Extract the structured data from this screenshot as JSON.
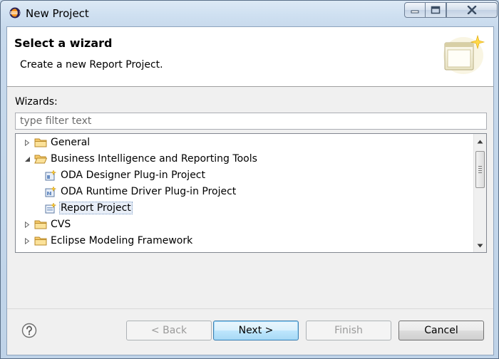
{
  "window": {
    "title": "New Project"
  },
  "header": {
    "title": "Select a wizard",
    "description": "Create a new Report Project."
  },
  "wizards": {
    "label": "Wizards:",
    "filter_placeholder": "type filter text",
    "tree": [
      {
        "label": "General",
        "type": "folder",
        "expanded": false,
        "level": 0
      },
      {
        "label": "Business Intelligence and Reporting Tools",
        "type": "folder",
        "expanded": true,
        "level": 0
      },
      {
        "label": "ODA Designer Plug-in Project",
        "type": "project",
        "level": 1
      },
      {
        "label": "ODA Runtime Driver Plug-in Project",
        "type": "project",
        "level": 1
      },
      {
        "label": "Report Project",
        "type": "project",
        "level": 1,
        "selected": true
      },
      {
        "label": "CVS",
        "type": "folder",
        "expanded": false,
        "level": 0
      },
      {
        "label": "Eclipse Modeling Framework",
        "type": "folder",
        "expanded": false,
        "level": 0
      }
    ]
  },
  "buttons": {
    "back": "< Back",
    "next": "Next >",
    "finish": "Finish",
    "cancel": "Cancel"
  },
  "icons": {
    "app": "eclipse-icon",
    "help": "help-icon",
    "banner": "new-wizard-banner-icon",
    "folder": "folder-icon",
    "project": "report-project-icon"
  },
  "colors": {
    "title_bar": "#c9dbed",
    "selection": "#e8eef7",
    "default_button": "#3c7fb1"
  }
}
